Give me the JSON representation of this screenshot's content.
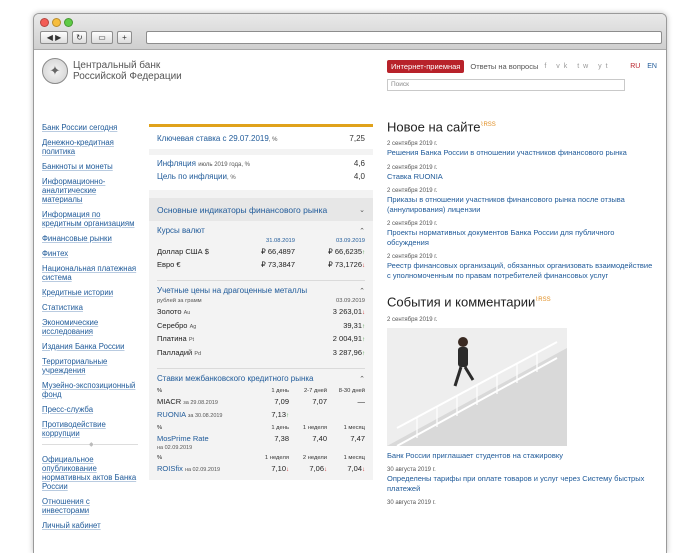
{
  "logo": {
    "line1": "Центральный банк",
    "line2": "Российской Федерации"
  },
  "header": {
    "reception": "Интернет-приемная",
    "faq": "Ответы на вопросы",
    "social": "f  vk  tw  yt",
    "lang_ru": "RU",
    "lang_en": "EN",
    "search_placeholder": "Поиск"
  },
  "sidebar": [
    "Банк России сегодня",
    "Денежно-кредитная политика",
    "Банкноты и монеты",
    "Информационно-аналитические материалы",
    "Информация по кредитным организациям",
    "Финансовые рынки",
    "Финтех",
    "Национальная платежная система",
    "Кредитные истории",
    "Статистика",
    "Экономические исследования",
    "Издания Банка России",
    "Территориальные учреждения",
    "Музейно-экспозиционный фонд",
    "Пресс-служба",
    "Противодействие коррупции"
  ],
  "sidebar_bottom": [
    "Официальное опубликование нормативных актов Банка России",
    "Отношения с инвесторами",
    "Личный кабинет"
  ],
  "key_rate": {
    "label": "Ключевая ставка с 29.07.2019",
    "unit": ", %",
    "value": "7,25"
  },
  "inflation": {
    "label": "Инфляция",
    "note": "июль 2019 года, %",
    "value": "4,6"
  },
  "target": {
    "label": "Цель по инфляции",
    "note": ", %",
    "value": "4,0"
  },
  "indicators_title": "Основные индикаторы финансового рынка",
  "fx": {
    "title": "Курсы валют",
    "date1": "31.08.2019",
    "date2": "03.09.2019",
    "rows": [
      {
        "name": "Доллар США $",
        "v1": "₽ 66,4897",
        "v2": "₽ 66,6235"
      },
      {
        "name": "Евро €",
        "v1": "₽ 73,3847",
        "v2": "₽ 73,1726"
      }
    ]
  },
  "metals": {
    "title": "Учетные цены на драгоценные металлы",
    "unit": "рублей за грамм",
    "date": "03.09.2019",
    "rows": [
      {
        "name": "Золото",
        "sym": "Au",
        "value": "3 263,01"
      },
      {
        "name": "Серебро",
        "sym": "Ag",
        "value": "39,31"
      },
      {
        "name": "Платина",
        "sym": "Pt",
        "value": "2 004,91"
      },
      {
        "name": "Палладий",
        "sym": "Pd",
        "value": "3 287,96"
      }
    ]
  },
  "interbank": {
    "title": "Ставки межбанковского кредитного рынка",
    "pct": "%",
    "h1": [
      "1 день",
      "2-7 дней",
      "8-30 дней"
    ],
    "miacr": {
      "name": "MIACR",
      "date": "за 29.08.2019",
      "v": [
        "7,09",
        "7,07",
        "—"
      ]
    },
    "ruonia": {
      "name": "RUONIA",
      "date": "за 30.08.2019",
      "v": "7,13"
    },
    "h2": [
      "1 день",
      "1 неделя",
      "1 месяц"
    ],
    "mosprime": {
      "name": "MosPrime Rate",
      "date": "на 02.09.2019",
      "v": [
        "7,38",
        "7,40",
        "7,47"
      ]
    },
    "h3": [
      "1 неделя",
      "2 недели",
      "1 месяц"
    ],
    "roisfix": {
      "name": "ROISfix",
      "date": "на 02.09.2019",
      "v": [
        "7,10",
        "7,06",
        "7,04"
      ]
    }
  },
  "news": {
    "title": "Новое на сайте",
    "rss": "RSS",
    "items": [
      {
        "date": "2 сентября 2019 г.",
        "text": "Решения Банка России в отношении участников финансового рынка"
      },
      {
        "date": "2 сентября 2019 г.",
        "text": "Ставка RUONIA"
      },
      {
        "date": "2 сентября 2019 г.",
        "text": "Приказы в отношении участников финансового рынка после отзыва (аннулирования) лицензии"
      },
      {
        "date": "2 сентября 2019 г.",
        "text": "Проекты нормативных документов Банка России для публичного обсуждения"
      },
      {
        "date": "2 сентября 2019 г.",
        "text": "Реестр финансовых организаций, обязанных организовать взаимодействие с уполномоченным по правам потребителей финансовых услуг"
      }
    ]
  },
  "events": {
    "title": "События и комментарии",
    "rss": "RSS",
    "photo_date": "2 сентября 2019 г.",
    "photo_caption": "Банк России приглашает студентов на стажировку",
    "items": [
      {
        "date": "30 августа 2019 г.",
        "text": "Определены тарифы при оплате товаров и услуг через Систему быстрых платежей"
      },
      {
        "date": "30 августа 2019 г.",
        "text": ""
      }
    ]
  }
}
